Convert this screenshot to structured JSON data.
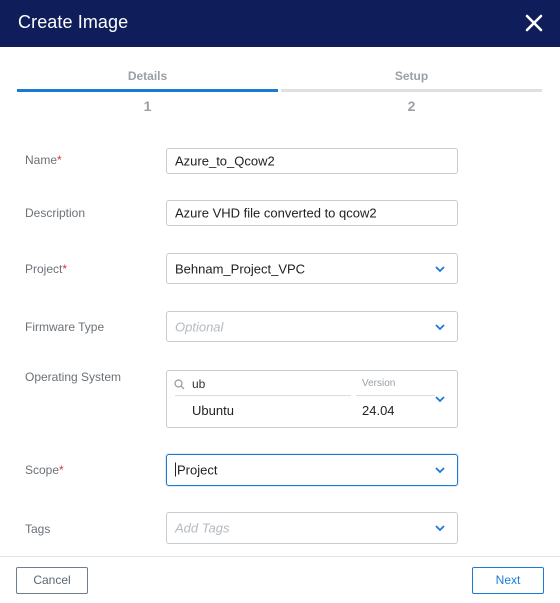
{
  "dialog": {
    "title": "Create Image"
  },
  "steps": [
    {
      "label": "Details",
      "number": "1",
      "active": true
    },
    {
      "label": "Setup",
      "number": "2",
      "active": false
    }
  ],
  "form": {
    "name": {
      "label": "Name",
      "required_mark": "*",
      "value": "Azure_to_Qcow2"
    },
    "description": {
      "label": "Description",
      "value": "Azure VHD file converted to qcow2"
    },
    "project": {
      "label": "Project",
      "required_mark": "*",
      "value": "Behnam_Project_VPC"
    },
    "firmware": {
      "label": "Firmware Type",
      "placeholder": "Optional"
    },
    "os": {
      "label": "Operating System",
      "search": "ub",
      "version_label": "Version",
      "name": "Ubuntu",
      "version": "24.04"
    },
    "scope": {
      "label": "Scope",
      "required_mark": "*",
      "value": "Project"
    },
    "tags": {
      "label": "Tags",
      "placeholder": "Add Tags"
    }
  },
  "footer": {
    "cancel": "Cancel",
    "next": "Next"
  },
  "colors": {
    "header": "#0f1e5a",
    "accent": "#1a7bd6",
    "required": "#d9333f"
  }
}
